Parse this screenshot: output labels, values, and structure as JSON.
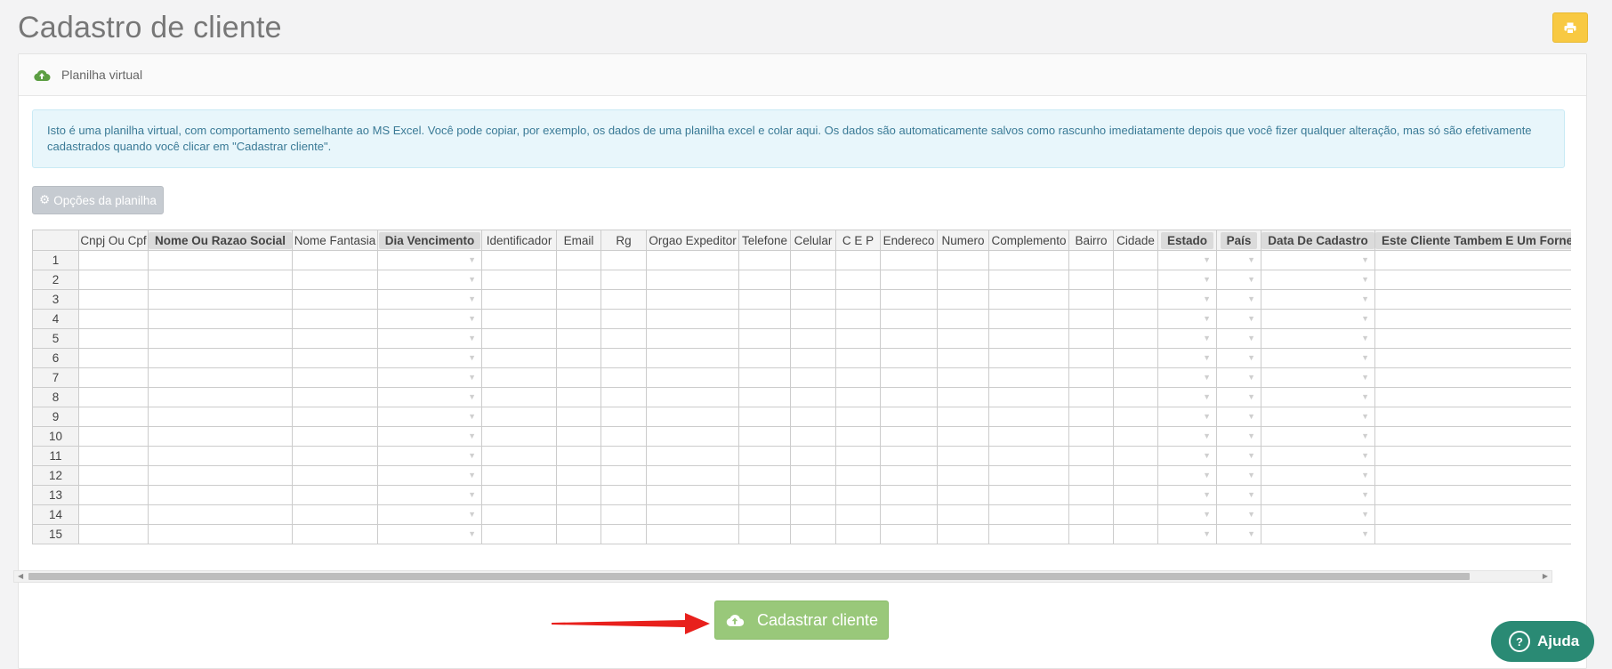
{
  "page": {
    "title": "Cadastro de cliente"
  },
  "toolbar": {
    "print_icon": "print-icon"
  },
  "panel": {
    "heading": "Planilha virtual",
    "heading_icon": "cloud-upload-icon",
    "alert": "Isto é uma planilha virtual, com comportamento semelhante ao MS Excel. Você pode copiar, por exemplo, os dados de uma planilha excel e colar aqui. Os dados são automaticamente salvos como rascunho imediatamente depois que você fizer qualquer alteração, mas só são efetivamente cadastrados quando você clicar em \"Cadastrar cliente\".",
    "options_button": "Opções da planilha",
    "options_icon": "gear-icon"
  },
  "sheet": {
    "columns": [
      {
        "label": "Cnpj Ou Cpf",
        "highlight": false,
        "dropdown": false
      },
      {
        "label": "Nome Ou Razao Social",
        "highlight": true,
        "dropdown": false
      },
      {
        "label": "Nome Fantasia",
        "highlight": false,
        "dropdown": false
      },
      {
        "label": "Dia Vencimento",
        "highlight": true,
        "dropdown": true
      },
      {
        "label": "Identificador",
        "highlight": false,
        "dropdown": false
      },
      {
        "label": "Email",
        "highlight": false,
        "dropdown": false
      },
      {
        "label": "Rg",
        "highlight": false,
        "dropdown": false
      },
      {
        "label": "Orgao Expeditor",
        "highlight": false,
        "dropdown": false
      },
      {
        "label": "Telefone",
        "highlight": false,
        "dropdown": false
      },
      {
        "label": "Celular",
        "highlight": false,
        "dropdown": false
      },
      {
        "label": "C E P",
        "highlight": false,
        "dropdown": false
      },
      {
        "label": "Endereco",
        "highlight": false,
        "dropdown": false
      },
      {
        "label": "Numero",
        "highlight": false,
        "dropdown": false
      },
      {
        "label": "Complemento",
        "highlight": false,
        "dropdown": false
      },
      {
        "label": "Bairro",
        "highlight": false,
        "dropdown": false
      },
      {
        "label": "Cidade",
        "highlight": false,
        "dropdown": false
      },
      {
        "label": "Estado",
        "highlight": true,
        "dropdown": true
      },
      {
        "label": "País",
        "highlight": true,
        "dropdown": true
      },
      {
        "label": "Data De Cadastro",
        "highlight": true,
        "dropdown": true
      },
      {
        "label": "Este Cliente Tambem E Um Fornecedor",
        "highlight": true,
        "dropdown": false
      }
    ],
    "rows": [
      "1",
      "2",
      "3",
      "4",
      "5",
      "6",
      "7",
      "8",
      "9",
      "10",
      "11",
      "12",
      "13",
      "14",
      "15"
    ]
  },
  "actions": {
    "submit_label": "Cadastrar cliente",
    "submit_icon": "cloud-upload-icon",
    "help_label": "Ajuda",
    "help_icon": "question-circle-icon"
  },
  "colors": {
    "print_button": "#f8c942",
    "submit_button": "#99c87a",
    "help_button": "#2a8a74",
    "annotation_arrow": "#e8201c"
  }
}
